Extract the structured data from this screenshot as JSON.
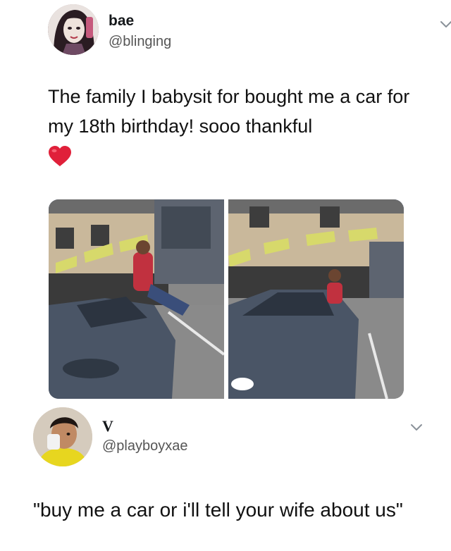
{
  "tweet1": {
    "display_name": "bae",
    "handle": "@blinging",
    "text": "The family I babysit for bought me a car for my 18th birthday! sooo thankful",
    "emoji": "red-heart",
    "avatar_icon": "profile-avatar",
    "menu_icon": "chevron-down-icon",
    "images": [
      "car-photo-left",
      "car-photo-right"
    ]
  },
  "tweet2": {
    "display_name": "V",
    "handle": "@playboyxae",
    "text": "\"buy me a car or i'll tell your wife about us\"",
    "avatar_icon": "profile-avatar",
    "menu_icon": "chevron-down-icon"
  },
  "colors": {
    "background": "#ffffff",
    "text": "#111111",
    "secondary_text": "#555555",
    "heart": "#e0203a",
    "car": "#4a5566"
  }
}
